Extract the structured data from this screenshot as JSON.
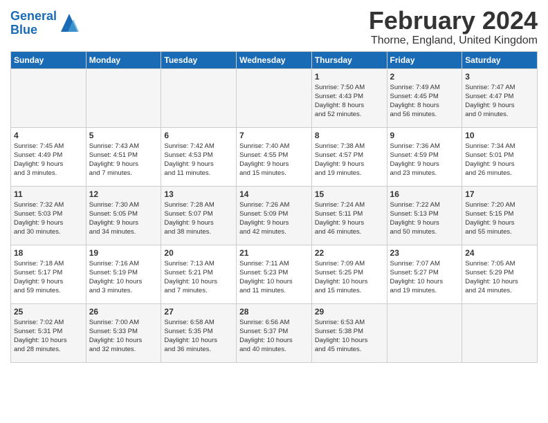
{
  "header": {
    "logo_line1": "General",
    "logo_line2": "Blue",
    "month": "February 2024",
    "location": "Thorne, England, United Kingdom"
  },
  "weekdays": [
    "Sunday",
    "Monday",
    "Tuesday",
    "Wednesday",
    "Thursday",
    "Friday",
    "Saturday"
  ],
  "weeks": [
    [
      {
        "day": "",
        "info": ""
      },
      {
        "day": "",
        "info": ""
      },
      {
        "day": "",
        "info": ""
      },
      {
        "day": "",
        "info": ""
      },
      {
        "day": "1",
        "info": "Sunrise: 7:50 AM\nSunset: 4:43 PM\nDaylight: 8 hours\nand 52 minutes."
      },
      {
        "day": "2",
        "info": "Sunrise: 7:49 AM\nSunset: 4:45 PM\nDaylight: 8 hours\nand 56 minutes."
      },
      {
        "day": "3",
        "info": "Sunrise: 7:47 AM\nSunset: 4:47 PM\nDaylight: 9 hours\nand 0 minutes."
      }
    ],
    [
      {
        "day": "4",
        "info": "Sunrise: 7:45 AM\nSunset: 4:49 PM\nDaylight: 9 hours\nand 3 minutes."
      },
      {
        "day": "5",
        "info": "Sunrise: 7:43 AM\nSunset: 4:51 PM\nDaylight: 9 hours\nand 7 minutes."
      },
      {
        "day": "6",
        "info": "Sunrise: 7:42 AM\nSunset: 4:53 PM\nDaylight: 9 hours\nand 11 minutes."
      },
      {
        "day": "7",
        "info": "Sunrise: 7:40 AM\nSunset: 4:55 PM\nDaylight: 9 hours\nand 15 minutes."
      },
      {
        "day": "8",
        "info": "Sunrise: 7:38 AM\nSunset: 4:57 PM\nDaylight: 9 hours\nand 19 minutes."
      },
      {
        "day": "9",
        "info": "Sunrise: 7:36 AM\nSunset: 4:59 PM\nDaylight: 9 hours\nand 23 minutes."
      },
      {
        "day": "10",
        "info": "Sunrise: 7:34 AM\nSunset: 5:01 PM\nDaylight: 9 hours\nand 26 minutes."
      }
    ],
    [
      {
        "day": "11",
        "info": "Sunrise: 7:32 AM\nSunset: 5:03 PM\nDaylight: 9 hours\nand 30 minutes."
      },
      {
        "day": "12",
        "info": "Sunrise: 7:30 AM\nSunset: 5:05 PM\nDaylight: 9 hours\nand 34 minutes."
      },
      {
        "day": "13",
        "info": "Sunrise: 7:28 AM\nSunset: 5:07 PM\nDaylight: 9 hours\nand 38 minutes."
      },
      {
        "day": "14",
        "info": "Sunrise: 7:26 AM\nSunset: 5:09 PM\nDaylight: 9 hours\nand 42 minutes."
      },
      {
        "day": "15",
        "info": "Sunrise: 7:24 AM\nSunset: 5:11 PM\nDaylight: 9 hours\nand 46 minutes."
      },
      {
        "day": "16",
        "info": "Sunrise: 7:22 AM\nSunset: 5:13 PM\nDaylight: 9 hours\nand 50 minutes."
      },
      {
        "day": "17",
        "info": "Sunrise: 7:20 AM\nSunset: 5:15 PM\nDaylight: 9 hours\nand 55 minutes."
      }
    ],
    [
      {
        "day": "18",
        "info": "Sunrise: 7:18 AM\nSunset: 5:17 PM\nDaylight: 9 hours\nand 59 minutes."
      },
      {
        "day": "19",
        "info": "Sunrise: 7:16 AM\nSunset: 5:19 PM\nDaylight: 10 hours\nand 3 minutes."
      },
      {
        "day": "20",
        "info": "Sunrise: 7:13 AM\nSunset: 5:21 PM\nDaylight: 10 hours\nand 7 minutes."
      },
      {
        "day": "21",
        "info": "Sunrise: 7:11 AM\nSunset: 5:23 PM\nDaylight: 10 hours\nand 11 minutes."
      },
      {
        "day": "22",
        "info": "Sunrise: 7:09 AM\nSunset: 5:25 PM\nDaylight: 10 hours\nand 15 minutes."
      },
      {
        "day": "23",
        "info": "Sunrise: 7:07 AM\nSunset: 5:27 PM\nDaylight: 10 hours\nand 19 minutes."
      },
      {
        "day": "24",
        "info": "Sunrise: 7:05 AM\nSunset: 5:29 PM\nDaylight: 10 hours\nand 24 minutes."
      }
    ],
    [
      {
        "day": "25",
        "info": "Sunrise: 7:02 AM\nSunset: 5:31 PM\nDaylight: 10 hours\nand 28 minutes."
      },
      {
        "day": "26",
        "info": "Sunrise: 7:00 AM\nSunset: 5:33 PM\nDaylight: 10 hours\nand 32 minutes."
      },
      {
        "day": "27",
        "info": "Sunrise: 6:58 AM\nSunset: 5:35 PM\nDaylight: 10 hours\nand 36 minutes."
      },
      {
        "day": "28",
        "info": "Sunrise: 6:56 AM\nSunset: 5:37 PM\nDaylight: 10 hours\nand 40 minutes."
      },
      {
        "day": "29",
        "info": "Sunrise: 6:53 AM\nSunset: 5:38 PM\nDaylight: 10 hours\nand 45 minutes."
      },
      {
        "day": "",
        "info": ""
      },
      {
        "day": "",
        "info": ""
      }
    ]
  ]
}
